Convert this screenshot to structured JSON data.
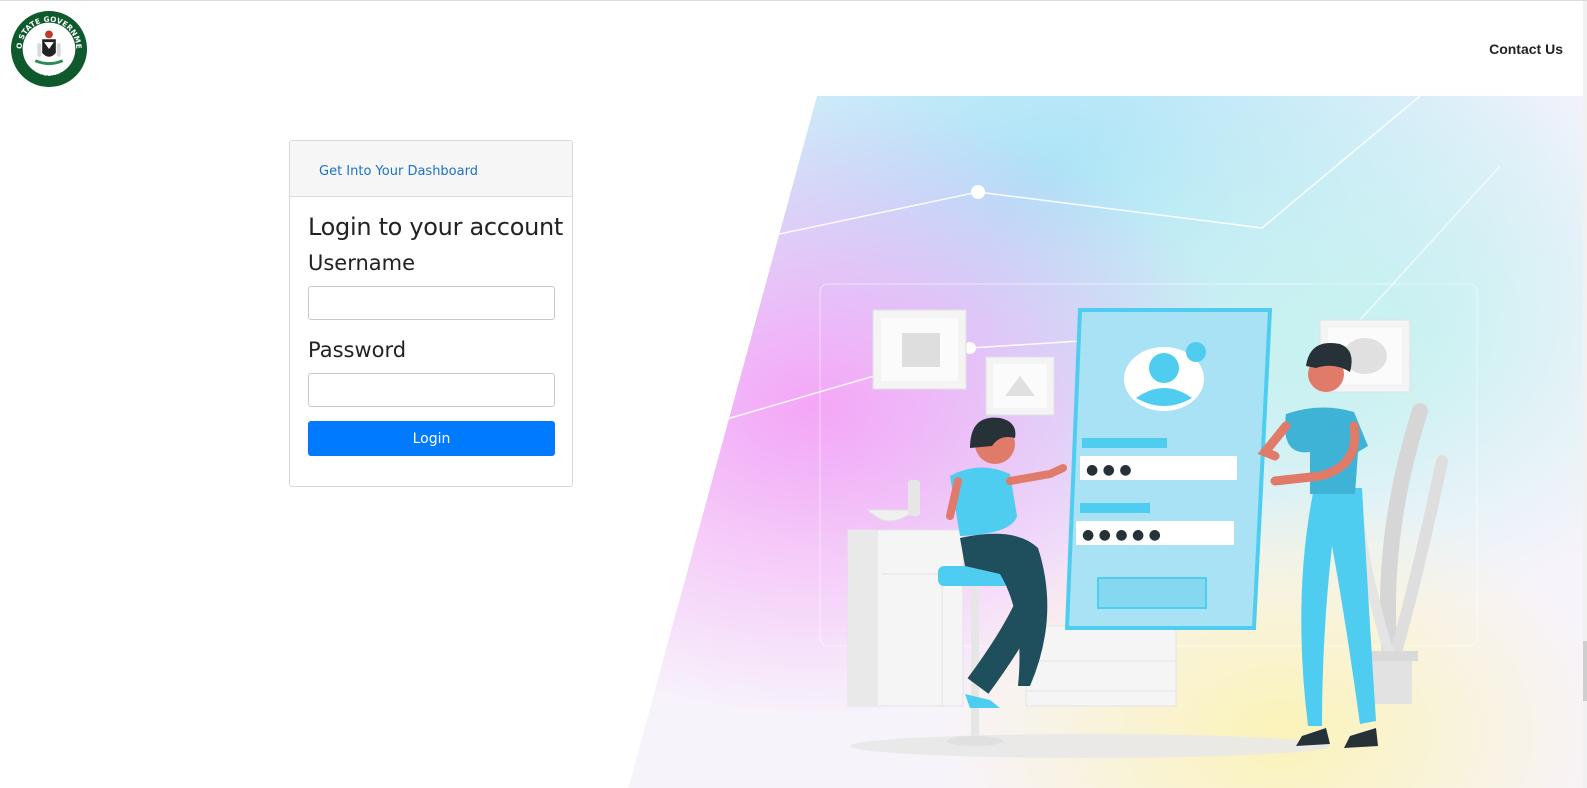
{
  "header": {
    "logo": {
      "top_text": "EDO STATE GOVERNMENT",
      "bottom_text": "NIGERIA"
    },
    "contact_label": "Contact Us"
  },
  "login_card": {
    "header_link": "Get Into Your Dashboard",
    "title": "Login to your account",
    "username_label": "Username",
    "username_value": "",
    "password_label": "Password",
    "password_value": "",
    "login_button": "Login"
  },
  "illustration": {
    "username_dots": "● ● ●",
    "password_dots": "● ● ● ● ●"
  },
  "colors": {
    "primary": "#007bff",
    "link": "#1b72c7",
    "illustration_accent": "#4fcdf0",
    "logo_green": "#0e5a2c"
  }
}
